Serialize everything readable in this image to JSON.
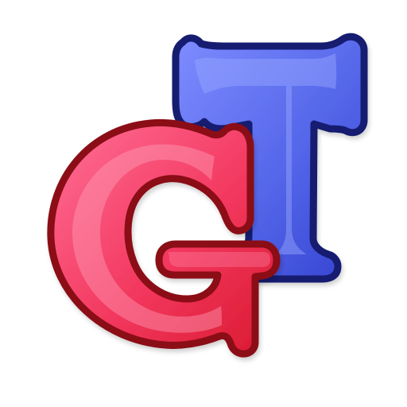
{
  "logo": {
    "letters": [
      "G",
      "T"
    ],
    "colors": {
      "background": "#ffffff",
      "g_fill_light": "#ff6f97",
      "g_fill_mid": "#f4365f",
      "g_fill_dark": "#d9192f",
      "g_outline": "#8b1017",
      "t_fill_light": "#7e8cff",
      "t_fill_mid": "#5264ea",
      "t_fill_dark": "#3442cf",
      "t_outline": "#121b70",
      "shadow": "#000000"
    }
  }
}
